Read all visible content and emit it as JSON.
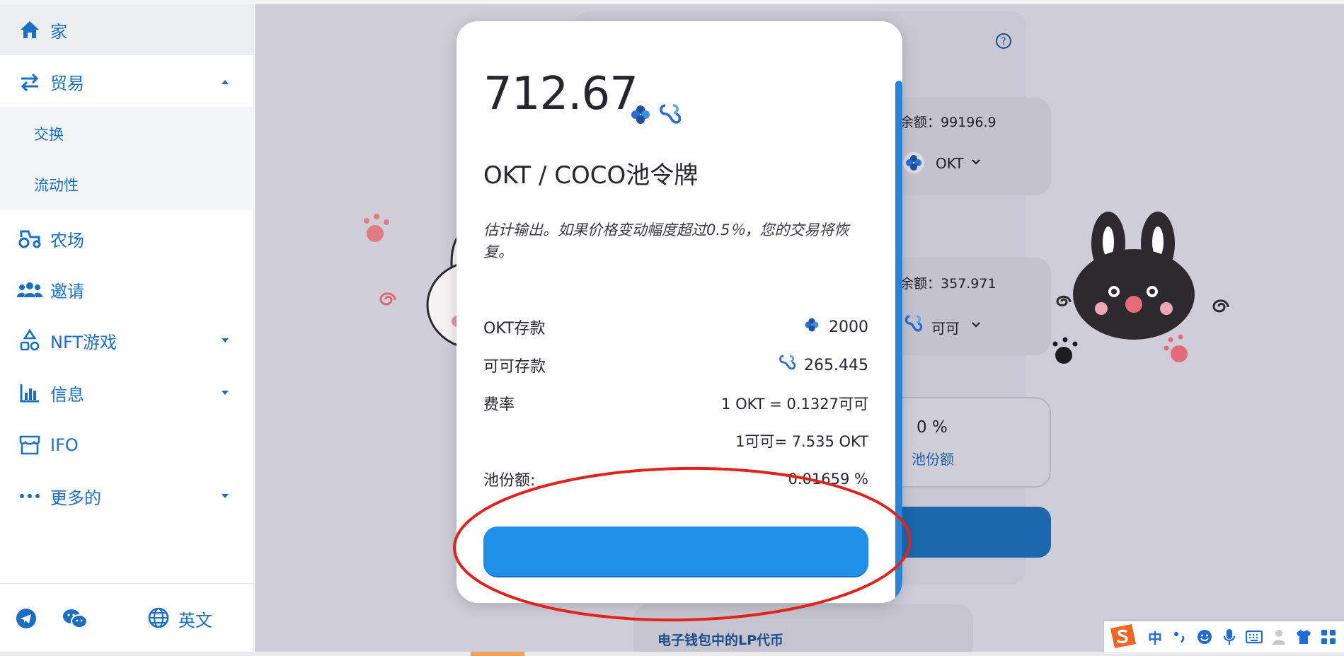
{
  "sidebar": {
    "items": [
      {
        "label": "家"
      },
      {
        "label": "贸易"
      },
      {
        "label": "农场"
      },
      {
        "label": "邀请"
      },
      {
        "label": "NFT游戏"
      },
      {
        "label": "信息"
      },
      {
        "label": "IFO"
      },
      {
        "label": "更多的"
      }
    ],
    "sub_items": [
      {
        "label": "交换"
      },
      {
        "label": "流动性"
      }
    ],
    "footer": {
      "language_label": "英文"
    }
  },
  "background": {
    "balance_1": "余额：99196.9",
    "token_1": "OKT",
    "balance_2": "余额：357.971",
    "token_2": "可可",
    "pool_share_value": "0 %",
    "pool_share_label": "池份额",
    "lp_tokens_label": "电子钱包中的LP代币"
  },
  "modal": {
    "amount": "712.67",
    "pool_token_title": "OKT / COCO池令牌",
    "notice": "估计输出。如果价格变动幅度超过0.5％，您的交易将恢复。",
    "rows": {
      "okt_deposit_label": "OKT存款",
      "okt_deposit_value": "2000",
      "coco_deposit_label": "可可存款",
      "coco_deposit_value": "265.445",
      "rate_label": "费率",
      "rate_value_1": "1 OKT = 0.1327可可",
      "rate_value_2": "1可可= 7.535 OKT",
      "pool_share_label": "池份额:",
      "pool_share_value": "0.01659 %"
    },
    "confirm_button_label": ""
  },
  "colors": {
    "accent": "#1f8fe8",
    "nav_text": "#1a6fc4",
    "annotation": "#e0231b"
  },
  "ime": {
    "lang": "中"
  }
}
